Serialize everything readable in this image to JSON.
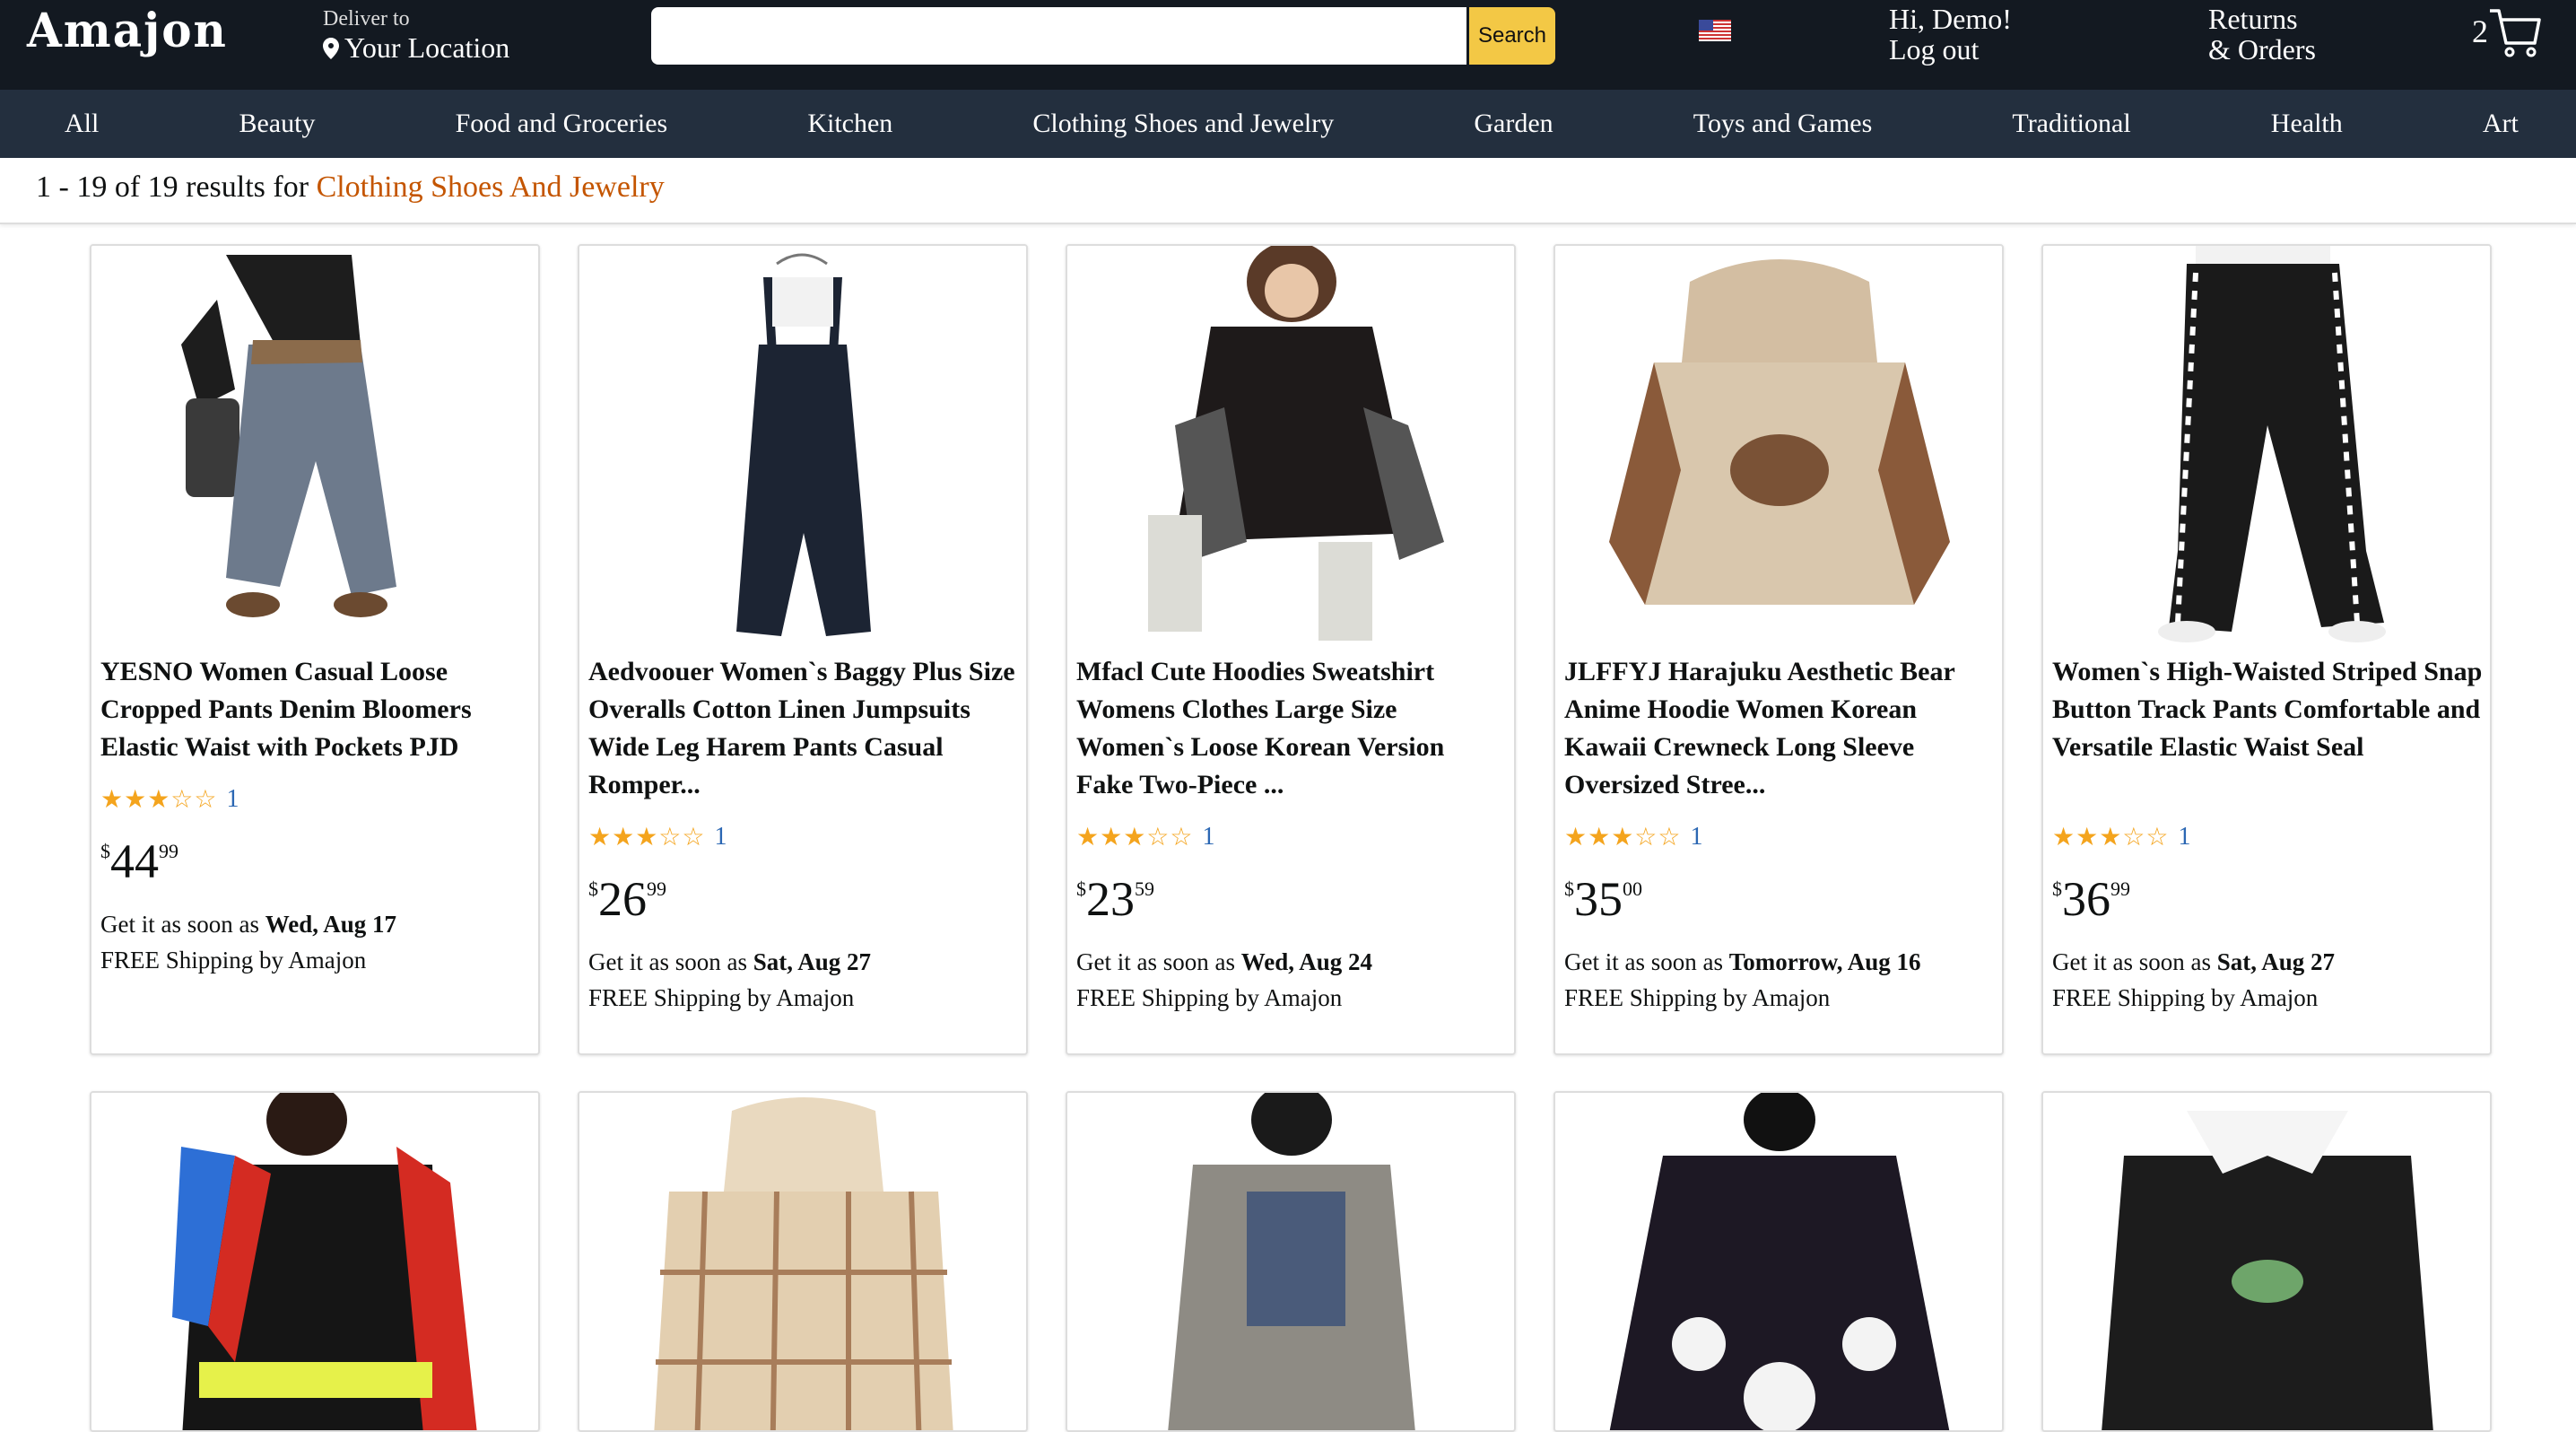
{
  "header": {
    "logo": "Amajon",
    "deliver_small": "Deliver to",
    "deliver_location": "Your Location",
    "search_placeholder": "",
    "search_button": "Search",
    "greeting": "Hi, Demo!",
    "logout": "Log out",
    "returns": "Returns",
    "orders": "& Orders",
    "cart_count": "2"
  },
  "nav": [
    "All",
    "Beauty",
    "Food and Groceries",
    "Kitchen",
    "Clothing Shoes and Jewelry",
    "Garden",
    "Toys and Games",
    "Traditional",
    "Health",
    "Art"
  ],
  "results": {
    "prefix": "1 - 19 of 19 results for ",
    "query": "Clothing Shoes And Jewelry"
  },
  "products": [
    {
      "title": "YESNO Women Casual Loose Cropped Pants Denim Bloomers Elastic Waist with Pockets PJD",
      "stars": "★★★☆☆",
      "rating_count": "1",
      "price_sym": "$",
      "price_whole": "44",
      "price_frac": "99",
      "delivery_prefix": "Get it as soon as ",
      "delivery_date": "Wed, Aug 17",
      "shipping": "FREE Shipping by Amajon"
    },
    {
      "title": "Aedvoouer Women`s Baggy Plus Size Overalls Cotton Linen Jumpsuits Wide Leg Harem Pants Casual Romper...",
      "stars": "★★★☆☆",
      "rating_count": "1",
      "price_sym": "$",
      "price_whole": "26",
      "price_frac": "99",
      "delivery_prefix": "Get it as soon as ",
      "delivery_date": "Sat, Aug 27",
      "shipping": "FREE Shipping by Amajon"
    },
    {
      "title": "Mfacl Cute Hoodies Sweatshirt Womens Clothes Large Size Women`s Loose Korean Version Fake Two-Piece ...",
      "stars": "★★★☆☆",
      "rating_count": "1",
      "price_sym": "$",
      "price_whole": "23",
      "price_frac": "59",
      "delivery_prefix": "Get it as soon as ",
      "delivery_date": "Wed, Aug 24",
      "shipping": "FREE Shipping by Amajon"
    },
    {
      "title": "JLFFYJ Harajuku Aesthetic Bear Anime Hoodie Women Korean Kawaii Crewneck Long Sleeve Oversized Stree...",
      "stars": "★★★☆☆",
      "rating_count": "1",
      "price_sym": "$",
      "price_whole": "35",
      "price_frac": "00",
      "delivery_prefix": "Get it as soon as ",
      "delivery_date": "Tomorrow, Aug 16",
      "shipping": "FREE Shipping by Amajon"
    },
    {
      "title": "Women`s High-Waisted Striped Snap Button Track Pants Comfortable and Versatile Elastic Waist Seal",
      "stars": "★★★☆☆",
      "rating_count": "1",
      "price_sym": "$",
      "price_whole": "36",
      "price_frac": "99",
      "delivery_prefix": "Get it as soon as ",
      "delivery_date": "Sat, Aug 27",
      "shipping": "FREE Shipping by Amajon"
    }
  ],
  "colors": {
    "header_bg": "#131921",
    "nav_bg": "#232f3e",
    "search_btn": "#f3c845",
    "query": "#c45500",
    "star": "#f4a41d",
    "link": "#2b67b3"
  }
}
